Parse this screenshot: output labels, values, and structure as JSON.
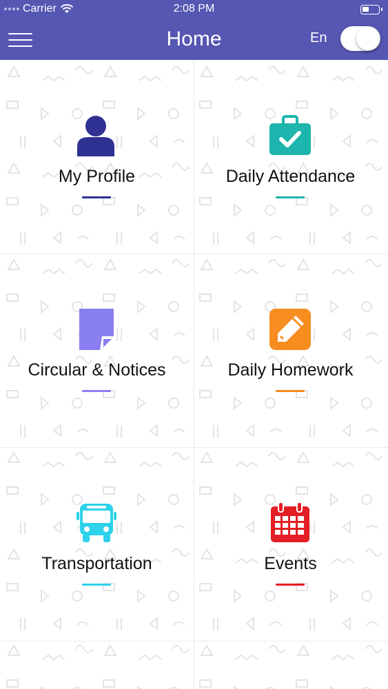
{
  "status_bar": {
    "carrier": "Carrier",
    "time": "2:08 PM"
  },
  "navbar": {
    "title": "Home",
    "language": "En",
    "language_toggle_on": true
  },
  "tiles": [
    {
      "label": "My Profile",
      "icon": "person-icon",
      "color": "#2e3192"
    },
    {
      "label": "Daily Attendance",
      "icon": "briefcase-check-icon",
      "color": "#1db5ad"
    },
    {
      "label": "Circular & Notices",
      "icon": "note-icon",
      "color": "#8a7ff0"
    },
    {
      "label": "Daily Homework",
      "icon": "pencil-icon",
      "color": "#f78c1f"
    },
    {
      "label": "Transportation",
      "icon": "bus-icon",
      "color": "#2ed2ea"
    },
    {
      "label": "Events",
      "icon": "calendar-icon",
      "color": "#e31e24"
    }
  ],
  "colors": {
    "header": "#5656b3"
  }
}
